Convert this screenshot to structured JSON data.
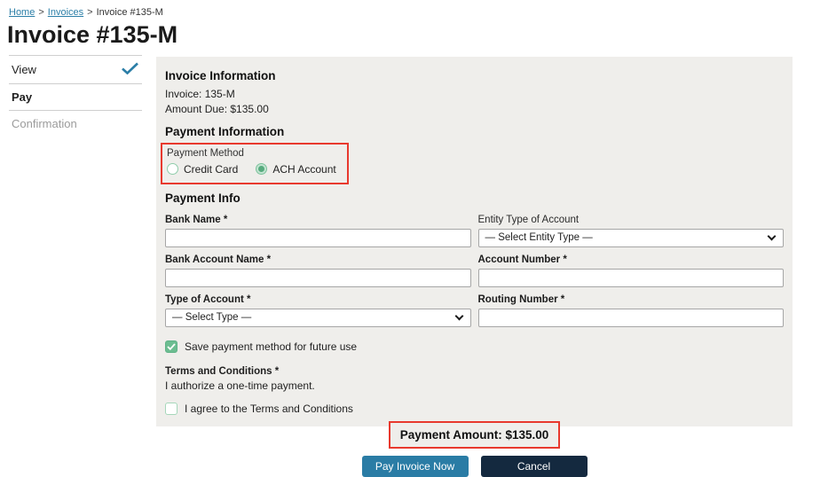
{
  "breadcrumb": {
    "separator": ">",
    "items": [
      {
        "label": "Home"
      },
      {
        "label": "Invoices"
      },
      {
        "label": "Invoice #135-M"
      }
    ]
  },
  "page_title": "Invoice #135-M",
  "sidebar": {
    "items": [
      {
        "label": "View",
        "state": "complete"
      },
      {
        "label": "Pay",
        "state": "active"
      },
      {
        "label": "Confirmation",
        "state": "disabled"
      }
    ]
  },
  "invoice_information": {
    "heading": "Invoice Information",
    "invoice_line": "Invoice: 135-M",
    "amount_line": "Amount Due: $135.00"
  },
  "payment_information": {
    "heading": "Payment Information",
    "method_label": "Payment Method",
    "methods": [
      {
        "label": "Credit Card",
        "selected": false
      },
      {
        "label": "ACH Account",
        "selected": true
      }
    ]
  },
  "payment_info": {
    "heading": "Payment Info",
    "fields": [
      {
        "label": "Bank Name *",
        "type": "input",
        "value": ""
      },
      {
        "label": "Entity Type of Account",
        "type": "select",
        "value": "— Select Entity Type —"
      },
      {
        "label": "Bank Account Name *",
        "type": "input",
        "value": ""
      },
      {
        "label": "Account Number *",
        "type": "input",
        "value": ""
      },
      {
        "label": "Type of Account *",
        "type": "select",
        "value": "— Select Type —"
      },
      {
        "label": "Routing Number *",
        "type": "input",
        "value": ""
      }
    ],
    "save_checkbox": {
      "label": "Save payment method for future use",
      "checked": true
    },
    "terms": {
      "heading": "Terms and Conditions *",
      "text": "I authorize a one-time payment.",
      "agree_label": "I agree to the Terms and Conditions",
      "checked": false
    }
  },
  "summary": {
    "payment_amount": "Payment Amount: $135.00"
  },
  "actions": {
    "pay_label": "Pay Invoice Now",
    "cancel_label": "Cancel"
  },
  "colors": {
    "accent_teal": "#2b7ea7",
    "button_navy": "#14293f",
    "highlight_red": "#e8392e",
    "check_green": "#6cbd91",
    "panel_bg": "#efeeeb"
  }
}
